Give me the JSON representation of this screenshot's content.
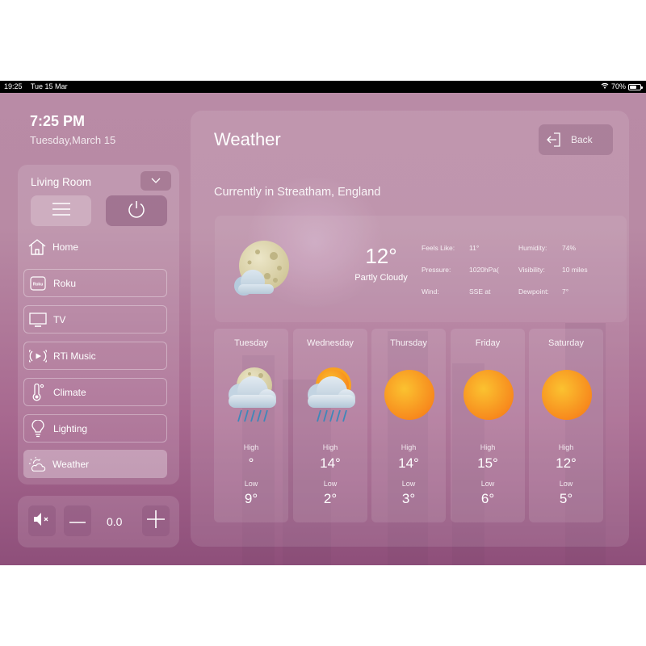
{
  "status_bar": {
    "time": "19:25",
    "date": "Tue 15 Mar",
    "battery": "70%",
    "battery_level": 0.7
  },
  "clock": {
    "time": "7:25 PM",
    "date": "Tuesday,March 15"
  },
  "room": {
    "name": "Living Room"
  },
  "nav": [
    {
      "label": "Home",
      "icon": "home-icon"
    },
    {
      "label": "Roku",
      "icon": "roku-icon",
      "icon_text": "Roku"
    },
    {
      "label": "TV",
      "icon": "tv-icon"
    },
    {
      "label": "RTi Music",
      "icon": "music-icon"
    },
    {
      "label": "Climate",
      "icon": "thermometer-icon"
    },
    {
      "label": "Lighting",
      "icon": "lightbulb-icon"
    },
    {
      "label": "Weather",
      "icon": "weather-icon",
      "active": true
    }
  ],
  "volume": {
    "value": "0.0"
  },
  "main": {
    "title": "Weather",
    "back_label": "Back",
    "location": "Currently in Streatham, England"
  },
  "current": {
    "temp": "12°",
    "condition": "Partly Cloudy",
    "details": [
      {
        "label": "Feels Like:",
        "value": "11°"
      },
      {
        "label": "Humidity:",
        "value": "74%"
      },
      {
        "label": "Pressure:",
        "value": "1020hPa("
      },
      {
        "label": "Visibility:",
        "value": "10 miles"
      },
      {
        "label": "Wind:",
        "value": "SSE at"
      },
      {
        "label": "Dewpoint:",
        "value": "7°"
      }
    ]
  },
  "forecast_labels": {
    "high": "High",
    "low": "Low"
  },
  "forecast": [
    {
      "day": "Tuesday",
      "icon": "moon-cloud-rain-icon",
      "high": "°",
      "low": "9°"
    },
    {
      "day": "Wednesday",
      "icon": "sun-cloud-rain-icon",
      "high": "14°",
      "low": "2°"
    },
    {
      "day": "Thursday",
      "icon": "sun-icon",
      "high": "14°",
      "low": "3°"
    },
    {
      "day": "Friday",
      "icon": "sun-icon",
      "high": "15°",
      "low": "6°"
    },
    {
      "day": "Saturday",
      "icon": "sun-icon",
      "high": "12°",
      "low": "5°"
    }
  ],
  "colors": {
    "sun": "#f9a21f",
    "moon": "#dcd3aa",
    "cloud": "#c9d6e2",
    "rain": "#3f87b9"
  }
}
